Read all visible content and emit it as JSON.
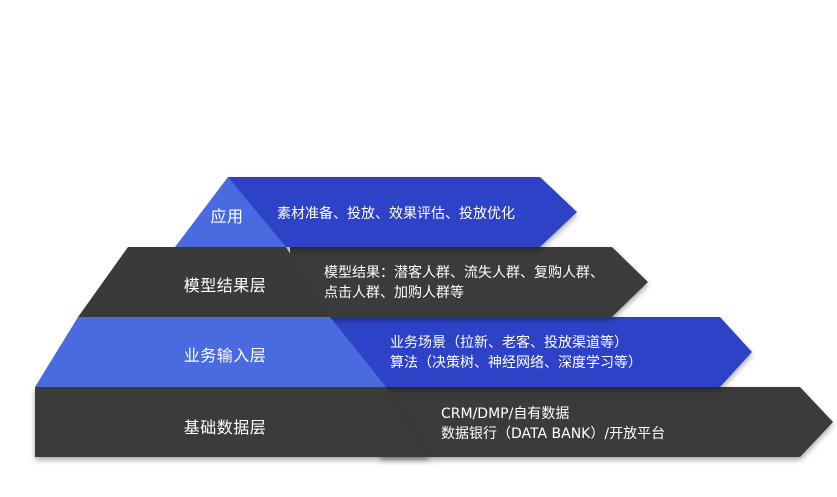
{
  "colors": {
    "blue": "#2f43c8",
    "light_blue": "#4a6ae0",
    "dark": "#3a3a3a",
    "text": "#ffffff"
  },
  "layers": [
    {
      "label": "应用",
      "lines": [
        "素材准备、投放、效果评估、投放优化"
      ]
    },
    {
      "label": "模型结果层",
      "lines": [
        "模型结果：潜客人群、流失人群、复购人群、",
        "点击人群、加购人群等"
      ]
    },
    {
      "label": "业务输入层",
      "lines": [
        "业务场景（拉新、老客、投放渠道等）",
        "算法（决策树、神经网络、深度学习等）"
      ]
    },
    {
      "label": "基础数据层",
      "lines": [
        "CRM/DMP/自有数据",
        "数据银行（DATA BANK）/开放平台"
      ]
    }
  ]
}
